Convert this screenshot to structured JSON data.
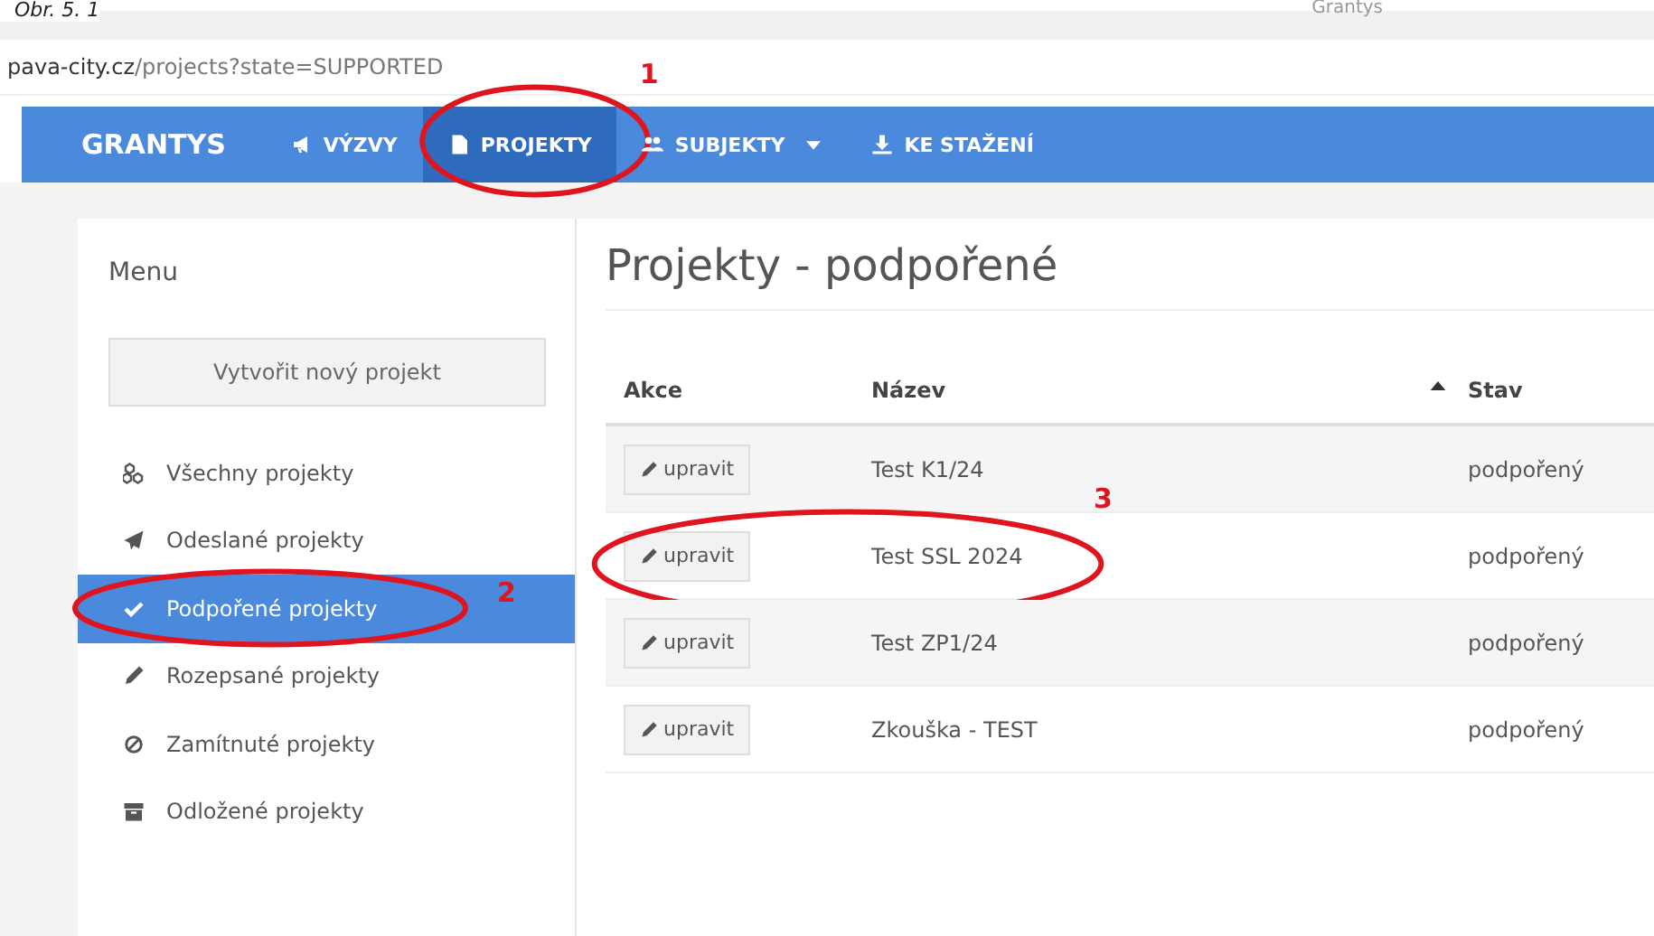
{
  "caption": "Obr. 5. 1",
  "browser_tab": {
    "title": "Grantys"
  },
  "address_bar": {
    "host": "pava-city.cz",
    "path": "/projects?state=SUPPORTED"
  },
  "navbar": {
    "brand": "GRANTYS",
    "items": [
      {
        "label": "VÝZVY",
        "kind": "bullhorn",
        "selected": false,
        "dropdown": false
      },
      {
        "label": "PROJEKTY",
        "kind": "file",
        "selected": true,
        "dropdown": false,
        "annotation": "1"
      },
      {
        "label": "SUBJEKTY",
        "kind": "users",
        "selected": false,
        "dropdown": true
      },
      {
        "label": "KE STAŽENÍ",
        "kind": "download",
        "selected": false,
        "dropdown": false
      }
    ]
  },
  "sidebar": {
    "title": "Menu",
    "create_button": "Vytvořit nový projekt",
    "items": [
      {
        "label": "Všechny projekty",
        "kind": "cubes",
        "selected": false
      },
      {
        "label": "Odeslané projekty",
        "kind": "plane",
        "selected": false
      },
      {
        "label": "Podpořené projekty",
        "kind": "check",
        "selected": true,
        "annotation": "2"
      },
      {
        "label": "Rozepsané projekty",
        "kind": "pencil",
        "selected": false
      },
      {
        "label": "Zamítnuté projekty",
        "kind": "ban",
        "selected": false
      },
      {
        "label": "Odložené projekty",
        "kind": "archive",
        "selected": false
      }
    ]
  },
  "main": {
    "title": "Projekty - podpořené",
    "table": {
      "columns": [
        {
          "label": "Akce"
        },
        {
          "label": "Název",
          "sorted": true
        },
        {
          "label": "Stav"
        }
      ],
      "rows": [
        {
          "action": "upravit",
          "name": "Test K1/24",
          "status": "podpořený"
        },
        {
          "action": "upravit",
          "name": "Test SSL 2024",
          "status": "podpořený",
          "annotation": "3"
        },
        {
          "action": "upravit",
          "name": "Test ZP1/24",
          "status": "podpořený"
        },
        {
          "action": "upravit",
          "name": "Zkouška - TEST",
          "status": "podpořený"
        }
      ]
    }
  }
}
